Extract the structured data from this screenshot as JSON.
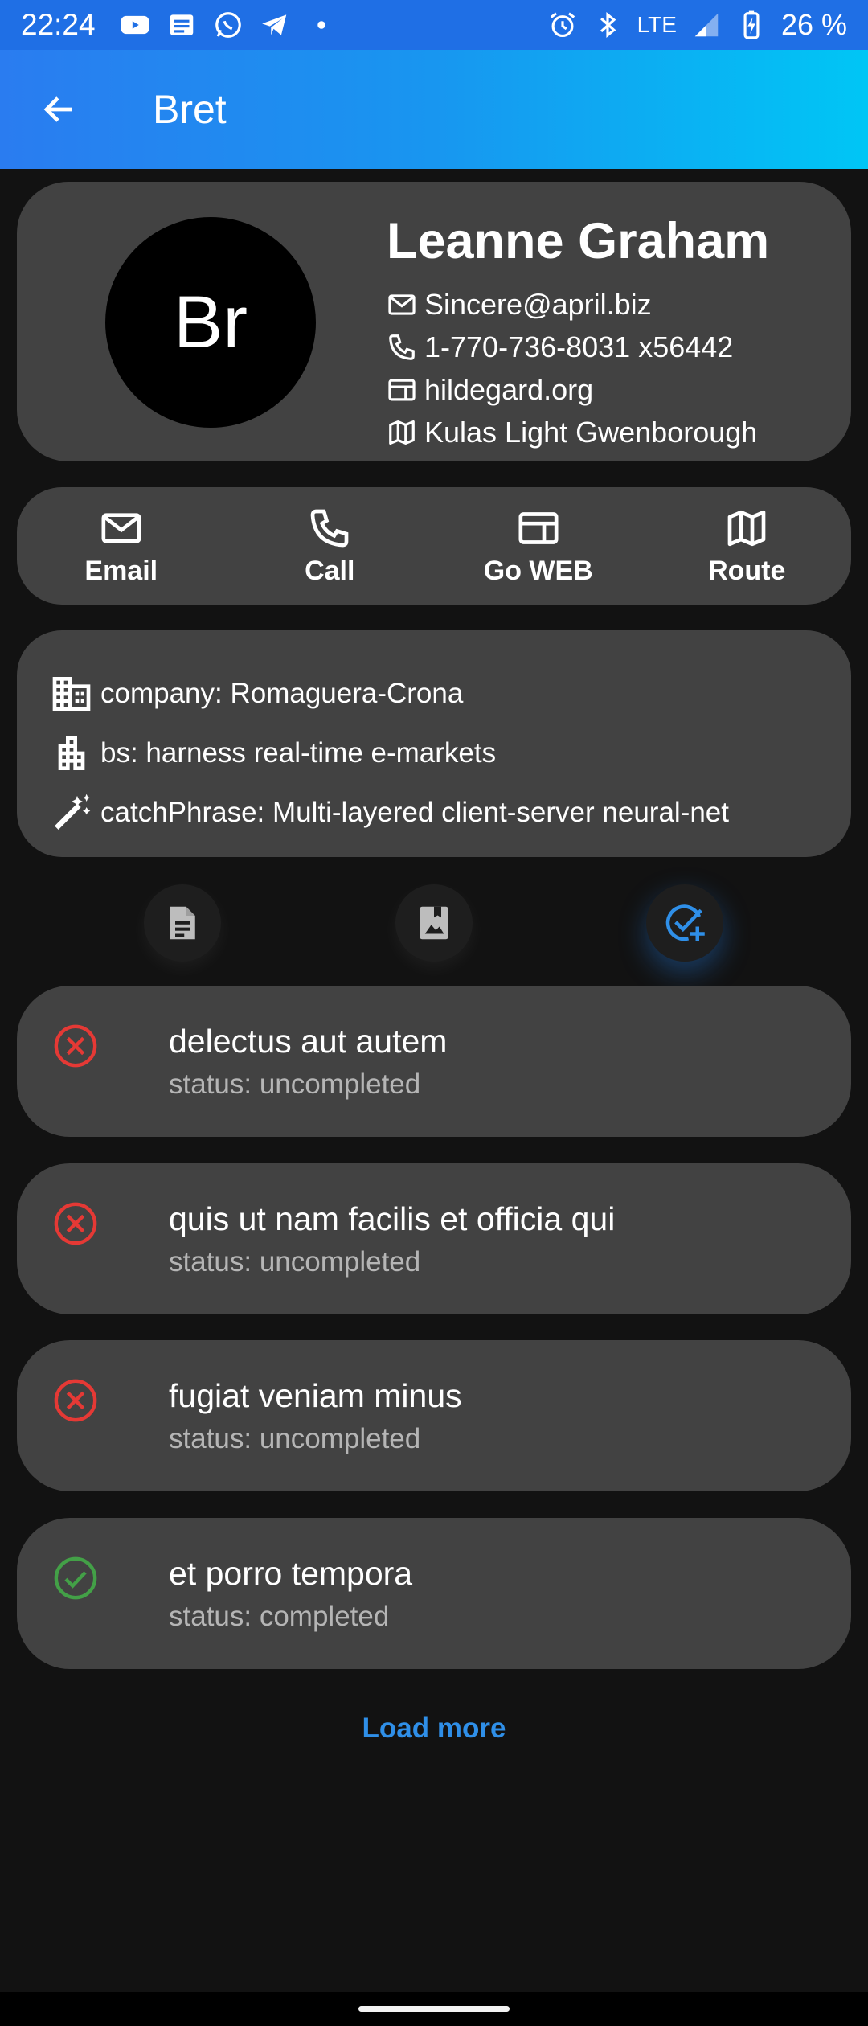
{
  "status_bar": {
    "time": "22:24",
    "network": "LTE",
    "battery": "26 %"
  },
  "app_bar": {
    "title": "Bret"
  },
  "profile": {
    "avatar_text": "Br",
    "name": "Leanne Graham",
    "email": "Sincere@april.biz",
    "phone": "1-770-736-8031 x56442",
    "website": "hildegard.org",
    "address": "Kulas Light Gwenborough"
  },
  "actions": [
    {
      "label": "Email",
      "icon": "email-icon"
    },
    {
      "label": "Call",
      "icon": "phone-icon"
    },
    {
      "label": "Go WEB",
      "icon": "web-icon"
    },
    {
      "label": "Route",
      "icon": "map-icon"
    }
  ],
  "company": {
    "name": "company: Romaguera-Crona",
    "bs": "bs: harness real-time e-markets",
    "catch_phrase": "catchPhrase: Multi-layered client-server neural-net"
  },
  "tabs": [
    {
      "name": "posts",
      "icon": "article-icon",
      "active": false
    },
    {
      "name": "albums",
      "icon": "photo-album-icon",
      "active": false
    },
    {
      "name": "todos",
      "icon": "add-task-icon",
      "active": true
    }
  ],
  "todos": [
    {
      "title": "delectus aut autem",
      "status": "status: uncompleted",
      "completed": false
    },
    {
      "title": "quis ut nam facilis et officia qui",
      "status": "status: uncompleted",
      "completed": false
    },
    {
      "title": "fugiat veniam minus",
      "status": "status: uncompleted",
      "completed": false
    },
    {
      "title": "et porro tempora",
      "status": "status: completed",
      "completed": true
    }
  ],
  "load_more_label": "Load more",
  "colors": {
    "accent": "#2f8fe8",
    "error": "#e53935",
    "success": "#43a047",
    "card": "#424242",
    "background": "#121212"
  }
}
